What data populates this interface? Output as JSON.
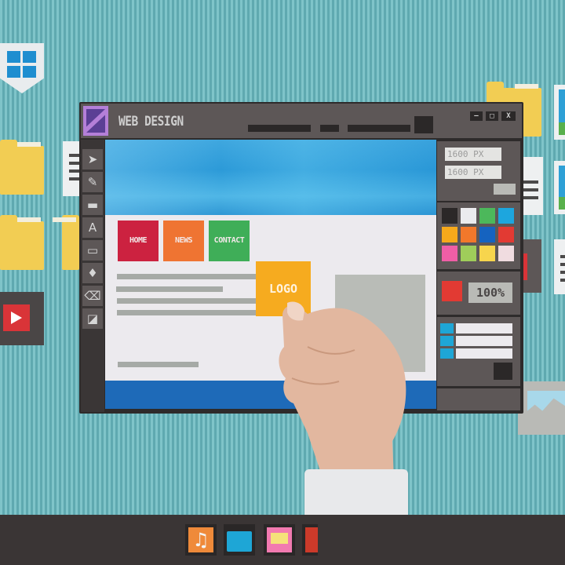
{
  "scene": {
    "description": "Paper-craft web design software window on a striped teal background, hand placing a LOGO card",
    "background_color": "#6bb7bd"
  },
  "window": {
    "title": "WEB DESIGN",
    "controls": [
      {
        "name": "minimize",
        "glyph": "—"
      },
      {
        "name": "maximize",
        "glyph": "□"
      },
      {
        "name": "close",
        "glyph": "X"
      }
    ]
  },
  "toolbar": {
    "tools": [
      {
        "name": "select",
        "glyph": "➤"
      },
      {
        "name": "brush",
        "glyph": "✎"
      },
      {
        "name": "rectangle-fill",
        "glyph": "▬"
      },
      {
        "name": "text",
        "glyph": "A"
      },
      {
        "name": "rectangle",
        "glyph": "▭"
      },
      {
        "name": "fill",
        "glyph": "♦"
      },
      {
        "name": "eraser",
        "glyph": "⌫"
      },
      {
        "name": "color-swap",
        "glyph": "◪"
      }
    ]
  },
  "canvas": {
    "nav": [
      {
        "label": "HOME",
        "color": "#cc2240"
      },
      {
        "label": "NEWS",
        "color": "#ef7432"
      },
      {
        "label": "CONTACT",
        "color": "#3fae58"
      }
    ],
    "logo_card": "LOGO",
    "hero_color": "#2f9dd9",
    "footer_color": "#1e6ab8"
  },
  "right_panel": {
    "size_fields": [
      "1600 PX",
      "1600 PX"
    ],
    "palette": [
      "#2b2828",
      "#ebebee",
      "#4cb85b",
      "#1da6de",
      "#f6a91b",
      "#f2782b",
      "#1563c0",
      "#e23a33",
      "#f05ea6",
      "#9fcd5a",
      "#f7d54d",
      "#f0dce0"
    ],
    "current_color": "#e23a33",
    "zoom_level": "100%",
    "layers": 3
  },
  "dock": {
    "items": [
      {
        "name": "music",
        "color": "#ef8a3a"
      },
      {
        "name": "folder",
        "color": "#1ea6d6"
      },
      {
        "name": "message",
        "color": "#f27ab0"
      },
      {
        "name": "video",
        "color": "#cc3a2a"
      }
    ]
  }
}
